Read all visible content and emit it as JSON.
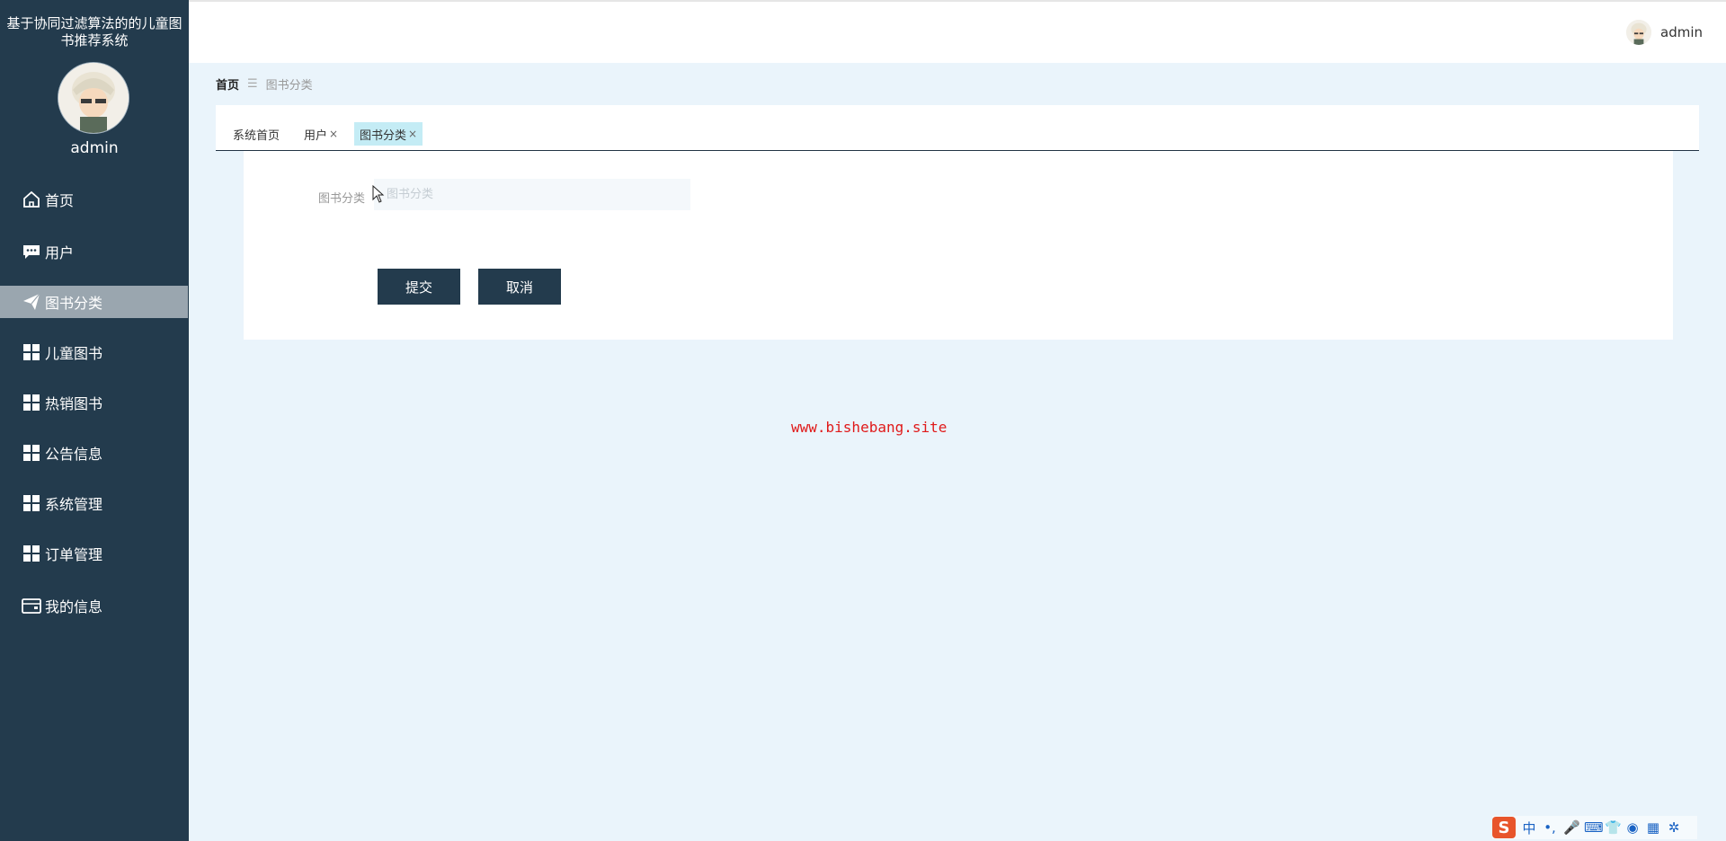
{
  "sidebar": {
    "system_title": "基于协同过滤算法的的儿童图书推荐系统",
    "user_name": "admin",
    "menu": [
      {
        "label": "首页",
        "icon": "home-icon"
      },
      {
        "label": "用户",
        "icon": "chat-icon"
      },
      {
        "label": "图书分类",
        "icon": "paper-plane-icon",
        "active": true
      },
      {
        "label": "儿童图书",
        "icon": "grid-icon"
      },
      {
        "label": "热销图书",
        "icon": "grid-icon"
      },
      {
        "label": "公告信息",
        "icon": "grid-icon"
      },
      {
        "label": "系统管理",
        "icon": "grid-icon"
      },
      {
        "label": "订单管理",
        "icon": "grid-icon"
      },
      {
        "label": "我的信息",
        "icon": "wallet-icon"
      }
    ]
  },
  "header": {
    "user_name": "admin"
  },
  "breadcrumb": {
    "home": "首页",
    "separator": "☰",
    "current": "图书分类"
  },
  "tabs": [
    {
      "label": "系统首页",
      "closable": false
    },
    {
      "label": "用户",
      "closable": true
    },
    {
      "label": "图书分类",
      "closable": true,
      "active": true
    }
  ],
  "tab_close_glyph": "×",
  "form": {
    "category_label": "图书分类",
    "category_placeholder": "图书分类",
    "category_value": "",
    "submit_label": "提交",
    "cancel_label": "取消"
  },
  "watermark": "www.bishebang.site",
  "ime_toolbar": {
    "logo": "S",
    "glyphs": [
      "中",
      "•,",
      "🎤",
      "⌨",
      "👕",
      "◉",
      "▦",
      "✲"
    ]
  },
  "colors": {
    "sidebar_bg": "#233b4d",
    "active_menu_bg": "#9aa6af",
    "active_tab_bg": "#c4ecf5",
    "button_bg": "#233b4d",
    "watermark": "#e01a1a"
  }
}
